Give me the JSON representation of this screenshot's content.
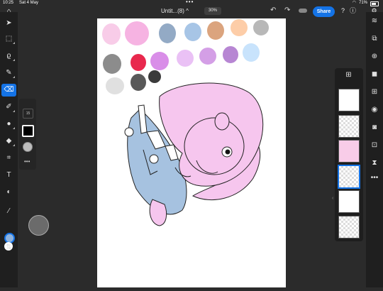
{
  "status": {
    "time": "10:25",
    "date": "Sat 4 May",
    "battery": "71%"
  },
  "topbar": {
    "doc_title": "Untit...(8) ^",
    "zoom": "30%",
    "share_label": "Share"
  },
  "brush": {
    "size": "15"
  },
  "colors": {
    "accent": "#1473e6",
    "primary_chip": "#8fb3dd",
    "secondary_chip": "#ffffff",
    "palette_row1": [
      "#f8cce8",
      "#f6b3e2",
      "#93aac5",
      "#a7c5e6",
      "#dba47e",
      "#fdcda8",
      "#b8b8b8"
    ],
    "palette_row2": [
      "#8c8c8c",
      "#e8284d",
      "#d98ee8",
      "#eac1f5",
      "#d49fe6",
      "#b786d3",
      "#c8e3fc"
    ],
    "palette_row3": [
      "#e0e0e0",
      "#595959",
      "#3b3b3b"
    ]
  },
  "layers": {
    "count": 6,
    "selected_index": 3
  }
}
